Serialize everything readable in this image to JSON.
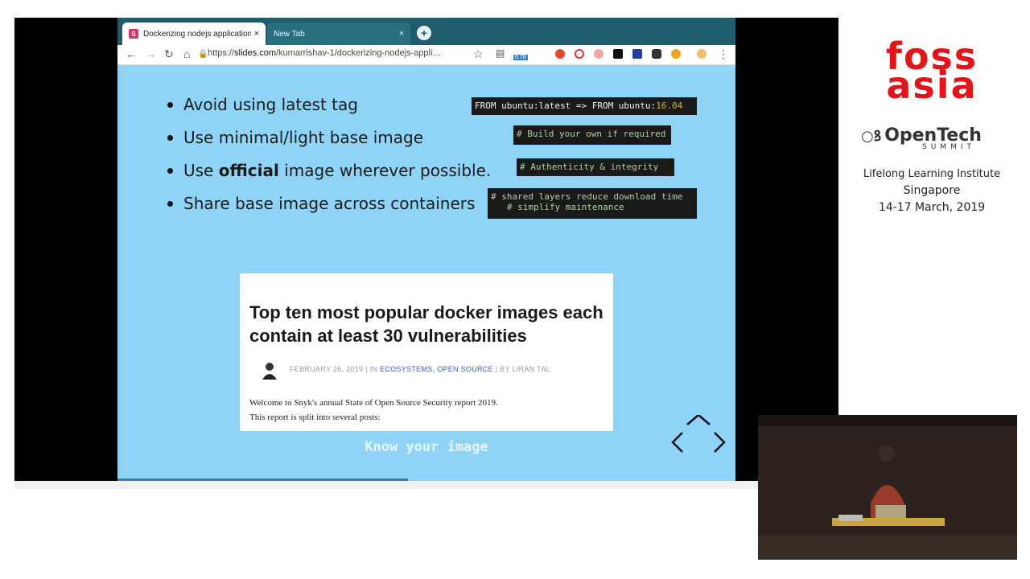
{
  "browser": {
    "tabs": [
      {
        "label": "Dockerizing nodejs application",
        "close": "×"
      },
      {
        "label": "New Tab",
        "close": "×"
      }
    ],
    "new_tab_symbol": "+",
    "favicon_letter": "S",
    "url_scheme": "https://",
    "url_host": "slides.com",
    "url_path": "/kumarrishav-1/dockerizing-nodejs-appli…",
    "extension_badge": "0.78"
  },
  "slide": {
    "bullets": [
      {
        "text": "Avoid using latest tag"
      },
      {
        "text_pre": "Use minimal/light base image"
      },
      {
        "text_pre": "Use ",
        "strong": "official",
        "text_post": " image wherever possible."
      },
      {
        "text": "Share base image across containers"
      }
    ],
    "code_1_a": "FROM ubuntu:latest => FROM ubuntu:",
    "code_1_b": "16.04",
    "code_2": "# Build your own if required",
    "code_3": "# Authenticity & integrity",
    "code_4a": "# shared layers reduce download time",
    "code_4b": "   # simplify maintenance",
    "article": {
      "title": "Top ten most popular docker images each contain at least 30 vulnerabilities",
      "date": "FEBRUARY 26, 2019",
      "in_label": "| IN ",
      "categories": "ECOSYSTEMS, OPEN SOURCE",
      "by": "| BY LIRAN TAL",
      "line1": "Welcome to Snyk's annual State of Open Source Security report 2019.",
      "line2": "This report is split into several posts:"
    },
    "caption": "Know your image",
    "progress": 0.47
  },
  "branding": {
    "foss": "foss",
    "asia": "asia",
    "opentech": "OpenTech",
    "summit": "SUMMIT",
    "venue": "Lifelong Learning Institute",
    "city": "Singapore",
    "dates": "14-17 March, 2019"
  },
  "colors": {
    "slide_bg": "#8fd3f7",
    "brand_red": "#e3151b",
    "tabbar": "#1f5d6e"
  }
}
